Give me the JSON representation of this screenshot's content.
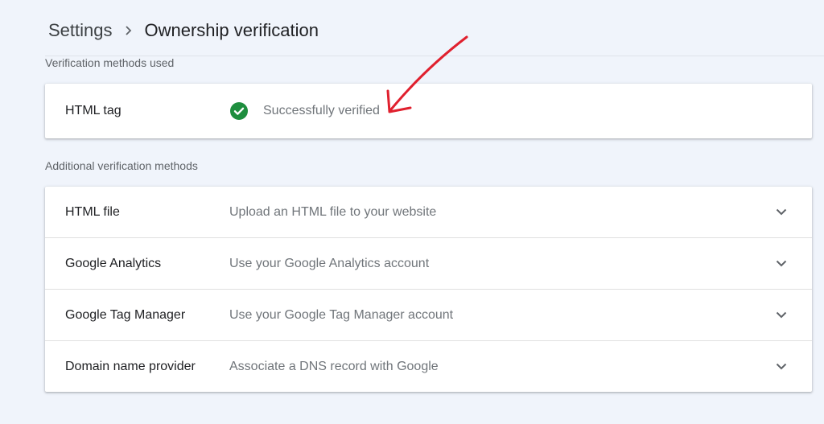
{
  "breadcrumb": {
    "parent": "Settings",
    "current": "Ownership verification"
  },
  "used_section": {
    "label": "Verification methods used",
    "method": {
      "name": "HTML tag",
      "status": "Successfully verified",
      "status_icon": "check-circle-icon",
      "status_color": "#1e8e3e"
    }
  },
  "additional_section": {
    "label": "Additional verification methods",
    "methods": [
      {
        "name": "HTML file",
        "description": "Upload an HTML file to your website"
      },
      {
        "name": "Google Analytics",
        "description": "Use your Google Analytics account"
      },
      {
        "name": "Google Tag Manager",
        "description": "Use your Google Tag Manager account"
      },
      {
        "name": "Domain name provider",
        "description": "Associate a DNS record with Google"
      }
    ]
  },
  "annotation": {
    "arrow_color": "#e0202e"
  }
}
